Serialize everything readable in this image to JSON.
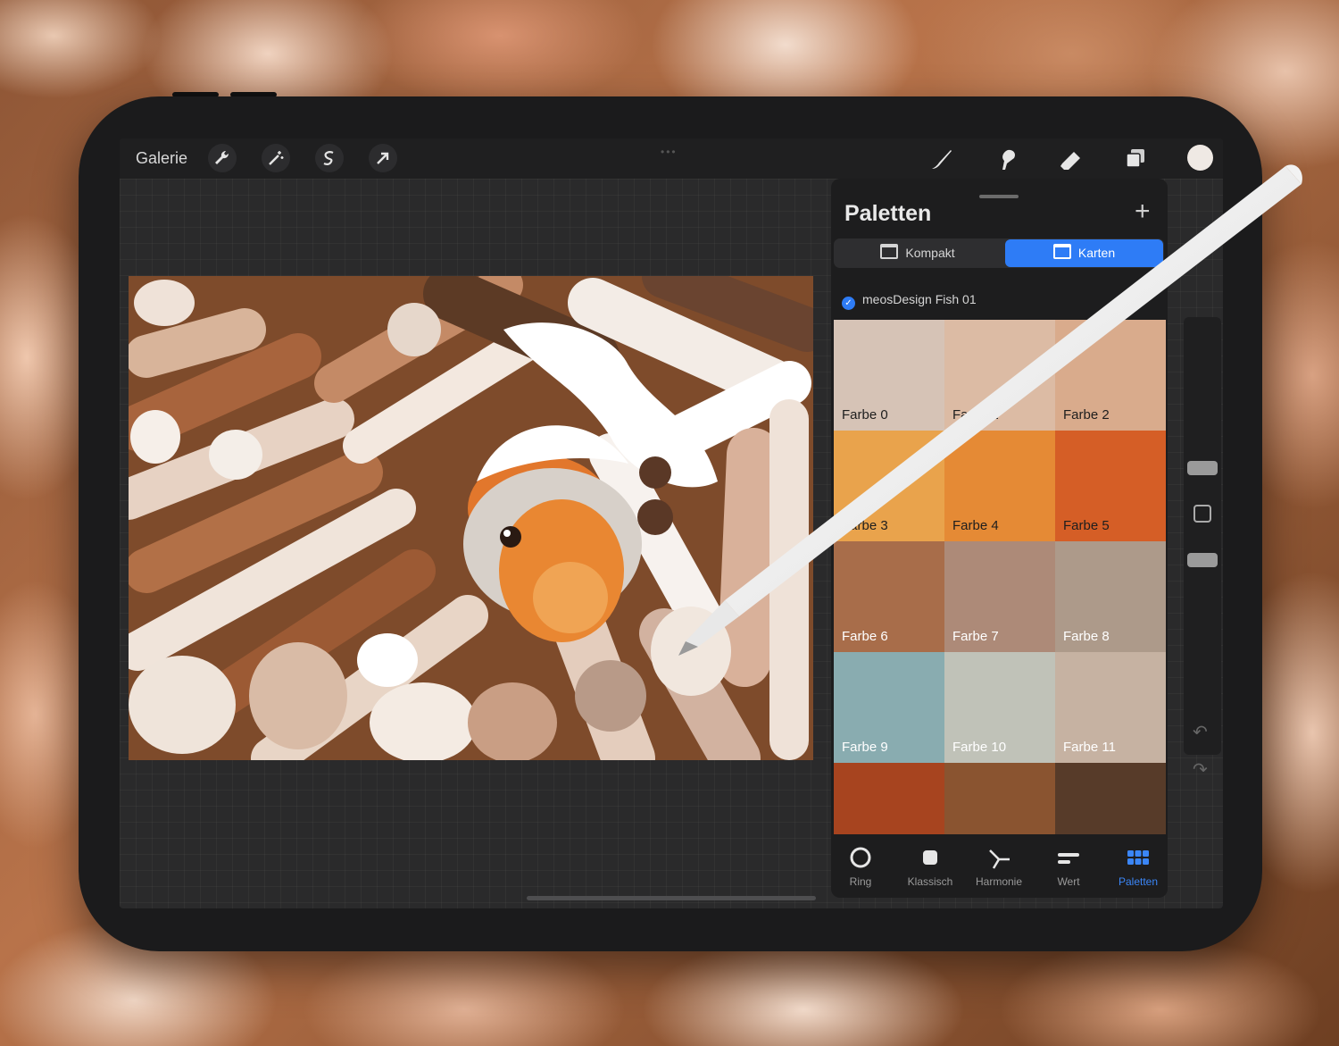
{
  "topbar": {
    "gallery_label": "Galerie",
    "left_tools": [
      "wrench-icon",
      "magic-wand-icon",
      "selection-icon",
      "transform-arrow-icon"
    ],
    "right_tools": [
      "brush-icon",
      "smudge-icon",
      "eraser-icon",
      "layers-icon",
      "color-well"
    ]
  },
  "panel": {
    "title": "Paletten",
    "add_icon": "plus-icon",
    "view_modes": [
      {
        "label": "Kompakt",
        "active": false
      },
      {
        "label": "Karten",
        "active": true
      }
    ],
    "palette_name": "meosDesign Fish 01",
    "swatches": [
      {
        "label": "Farbe 0",
        "color": "#d6c3b6",
        "text_color": "#1e1e1e"
      },
      {
        "label": "Farbe 1",
        "color": "#dcbba4",
        "text_color": "#1e1e1e"
      },
      {
        "label": "Farbe 2",
        "color": "#d9ab8c",
        "text_color": "#1e1e1e"
      },
      {
        "label": "Farbe 3",
        "color": "#e9a34c",
        "text_color": "#1e1e1e"
      },
      {
        "label": "Farbe 4",
        "color": "#e58a35",
        "text_color": "#1e1e1e"
      },
      {
        "label": "Farbe 5",
        "color": "#d55e26",
        "text_color": "#1e1e1e"
      },
      {
        "label": "Farbe 6",
        "color": "#a86d4a",
        "text_color": "#ffffff"
      },
      {
        "label": "Farbe 7",
        "color": "#ad8a78",
        "text_color": "#ffffff"
      },
      {
        "label": "Farbe 8",
        "color": "#ad9a8a",
        "text_color": "#ffffff"
      },
      {
        "label": "Farbe 9",
        "color": "#89acb0",
        "text_color": "#ffffff"
      },
      {
        "label": "Farbe 10",
        "color": "#c0c2b8",
        "text_color": "#ffffff"
      },
      {
        "label": "Farbe 11",
        "color": "#c6b2a2",
        "text_color": "#ffffff"
      },
      {
        "label": "",
        "color": "#a7441f",
        "text_color": "#ffffff"
      },
      {
        "label": "",
        "color": "#8a5430",
        "text_color": "#ffffff"
      },
      {
        "label": "",
        "color": "#573b29",
        "text_color": "#ffffff"
      }
    ],
    "tabs": [
      {
        "label": "Ring",
        "icon": "ring-icon",
        "active": false
      },
      {
        "label": "Klassisch",
        "icon": "classic-square-icon",
        "active": false
      },
      {
        "label": "Harmonie",
        "icon": "harmony-icon",
        "active": false
      },
      {
        "label": "Wert",
        "icon": "value-sliders-icon",
        "active": false
      },
      {
        "label": "Paletten",
        "icon": "palettes-grid-icon",
        "active": true
      }
    ]
  },
  "colors": {
    "accent": "#2e7cf6",
    "panel_bg": "#1d1d1e",
    "current_color": "#efe9e4"
  }
}
